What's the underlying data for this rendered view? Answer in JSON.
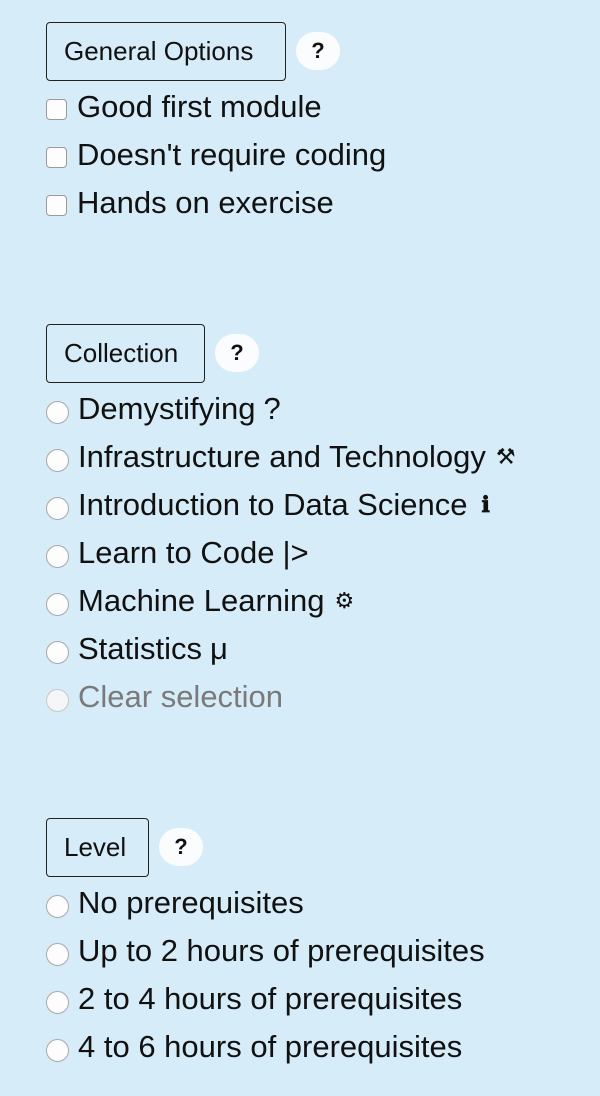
{
  "general": {
    "legend": "General Options",
    "help": "?",
    "options": [
      {
        "label": "Good first module"
      },
      {
        "label": "Doesn't require coding"
      },
      {
        "label": "Hands on exercise"
      }
    ]
  },
  "collection": {
    "legend": "Collection",
    "help": "?",
    "options": [
      {
        "label": "Demystifying",
        "suffix": "?",
        "icon": "question-mark-icon"
      },
      {
        "label": "Infrastructure and Technology",
        "suffix": "⚒",
        "icon": "hammer-pick-icon"
      },
      {
        "label": "Introduction to Data Science",
        "suffix": "ℹ",
        "icon": "info-icon"
      },
      {
        "label": "Learn to Code",
        "suffix": "|>",
        "icon": "code-prompt-icon"
      },
      {
        "label": "Machine Learning",
        "suffix": "⚙",
        "icon": "gear-icon"
      },
      {
        "label": "Statistics",
        "suffix": "μ",
        "icon": "mu-icon"
      },
      {
        "label": "Clear selection"
      }
    ]
  },
  "level": {
    "legend": "Level",
    "help": "?",
    "options": [
      {
        "label": "No prerequisites"
      },
      {
        "label": "Up to 2 hours of prerequisites"
      },
      {
        "label": "2 to 4 hours of prerequisites"
      },
      {
        "label": "4 to 6 hours of prerequisites"
      }
    ]
  }
}
